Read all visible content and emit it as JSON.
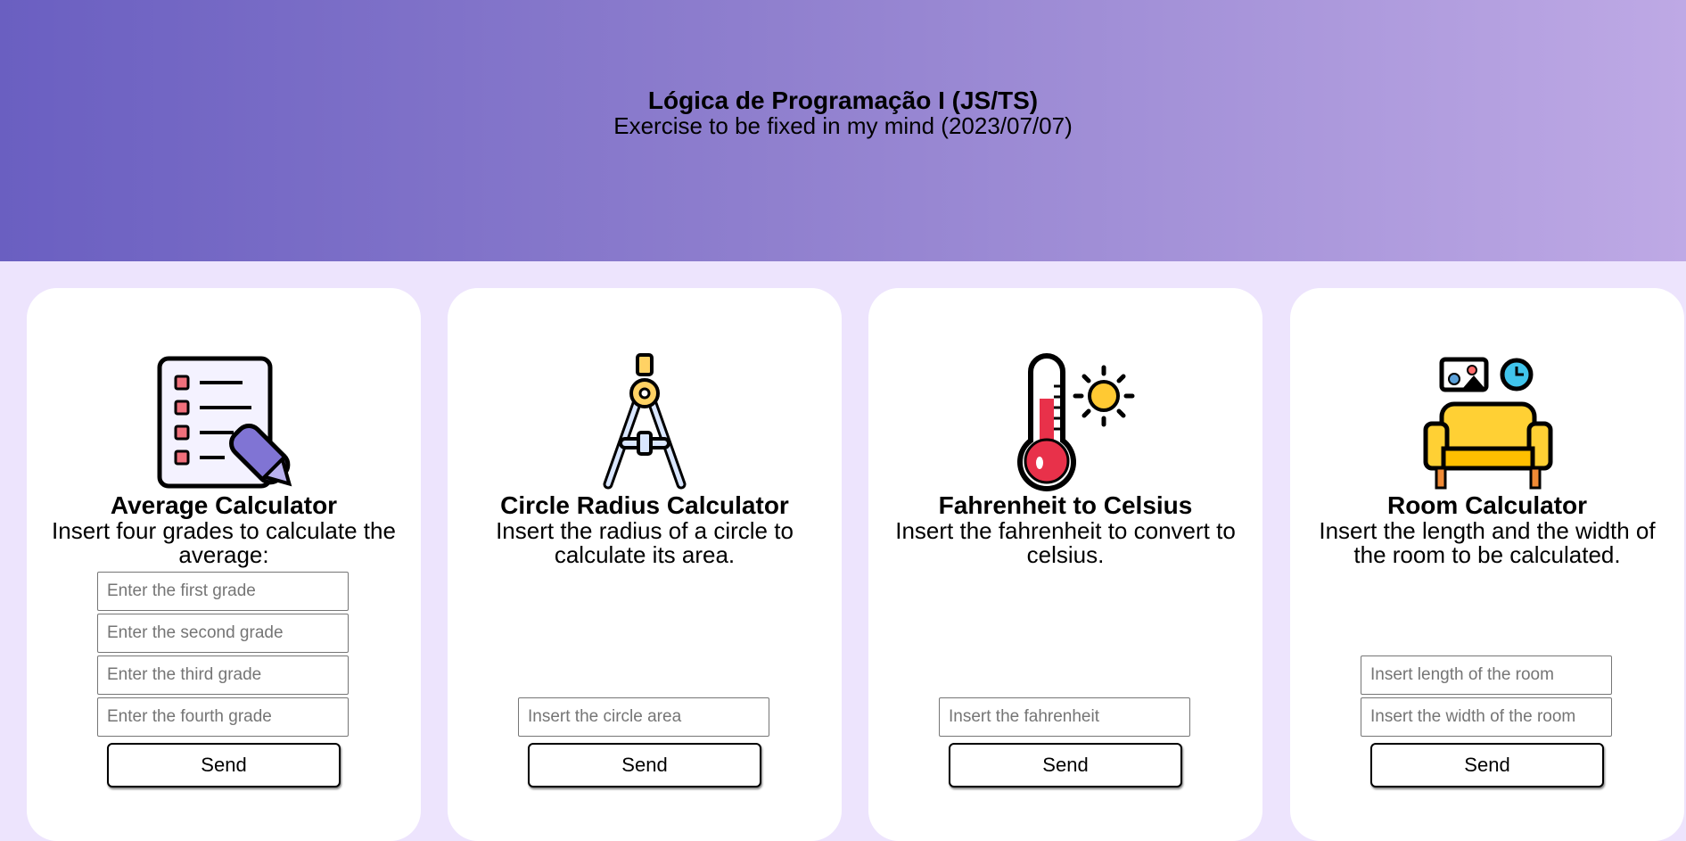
{
  "header": {
    "title": "Lógica de Programação I (JS/TS)",
    "subtitle": "Exercise to be fixed in my mind (2023/07/07)"
  },
  "cards": [
    {
      "title": "Average Calculator",
      "description": "Insert four grades to calculate the average:",
      "icon": "checklist-pencil-icon",
      "inputs": [
        "Enter the first grade",
        "Enter the second grade",
        "Enter the third grade",
        "Enter the fourth grade"
      ],
      "button": "Send"
    },
    {
      "title": "Circle Radius Calculator",
      "description": "Insert the radius of a circle to calculate its area.",
      "icon": "drawing-compass-icon",
      "inputs": [
        "Insert the circle area"
      ],
      "button": "Send"
    },
    {
      "title": "Fahrenheit to Celsius",
      "description": "Insert the fahrenheit to convert to celsius.",
      "icon": "thermometer-sun-icon",
      "inputs": [
        "Insert the fahrenheit"
      ],
      "button": "Send"
    },
    {
      "title": "Room Calculator",
      "description": "Insert the length and the width of the room to be calculated.",
      "icon": "sofa-room-icon",
      "inputs": [
        "Insert length of the room",
        "Insert the width of the room"
      ],
      "button": "Send"
    }
  ]
}
